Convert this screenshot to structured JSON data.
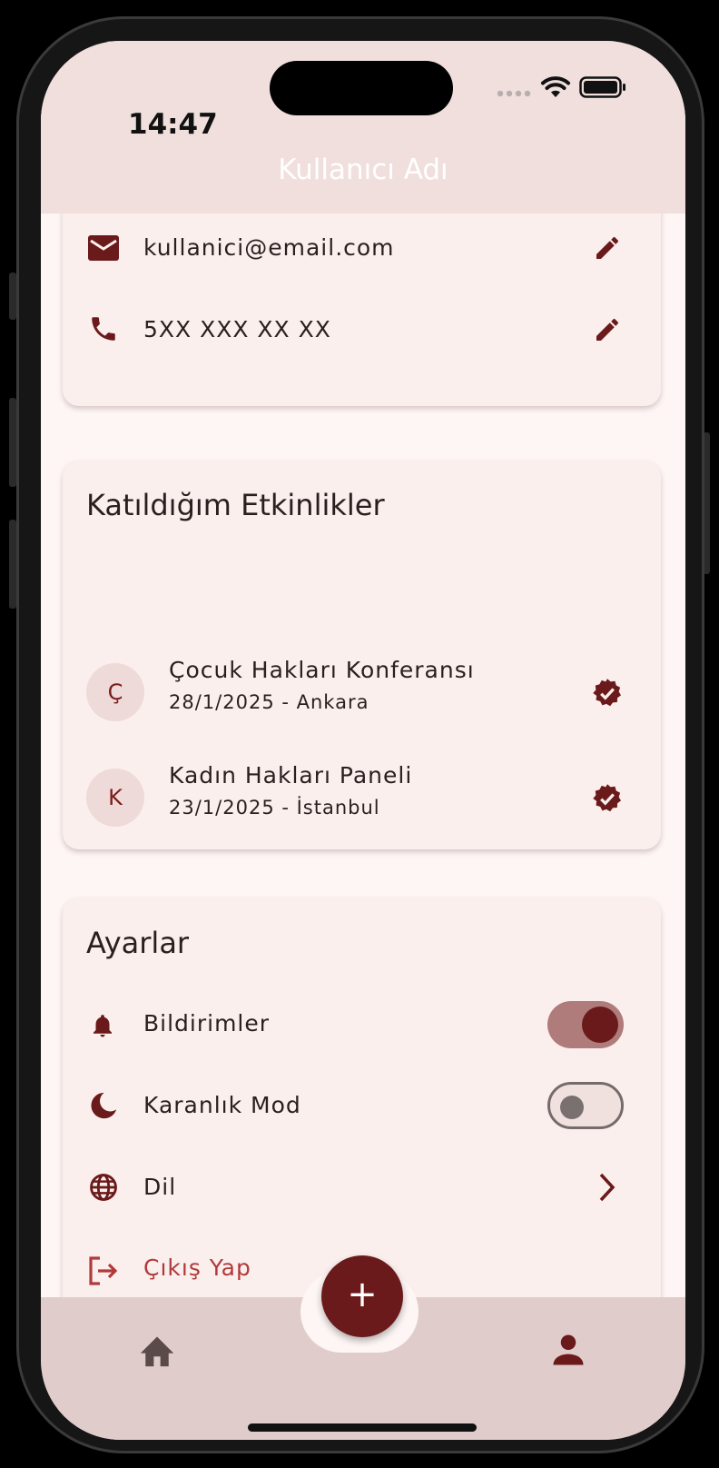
{
  "status": {
    "time": "14:47"
  },
  "appbar": {
    "title": "Kullanıcı Adı"
  },
  "contact": {
    "email": "kullanici@email.com",
    "phone": "5XX XXX XX XX"
  },
  "events": {
    "title": "Katıldığım Etkinlikler",
    "items": [
      {
        "initial": "Ç",
        "title": "Çocuk Hakları Konferansı",
        "subtitle": "28/1/2025 - Ankara"
      },
      {
        "initial": "K",
        "title": "Kadın Hakları Paneli",
        "subtitle": "23/1/2025 - İstanbul"
      }
    ]
  },
  "settings": {
    "title": "Ayarlar",
    "notifications": {
      "label": "Bildirimler",
      "enabled": true
    },
    "dark_mode": {
      "label": "Karanlık Mod",
      "enabled": false
    },
    "language": {
      "label": "Dil"
    },
    "logout": {
      "label": "Çıkış Yap"
    }
  },
  "fab": {
    "label": "+"
  },
  "colors": {
    "primary": "#6a1a1a",
    "appbar": "#f0dfdd",
    "card": "#fbefee",
    "navbar": "#e0cccb",
    "logout": "#b03a3a"
  }
}
